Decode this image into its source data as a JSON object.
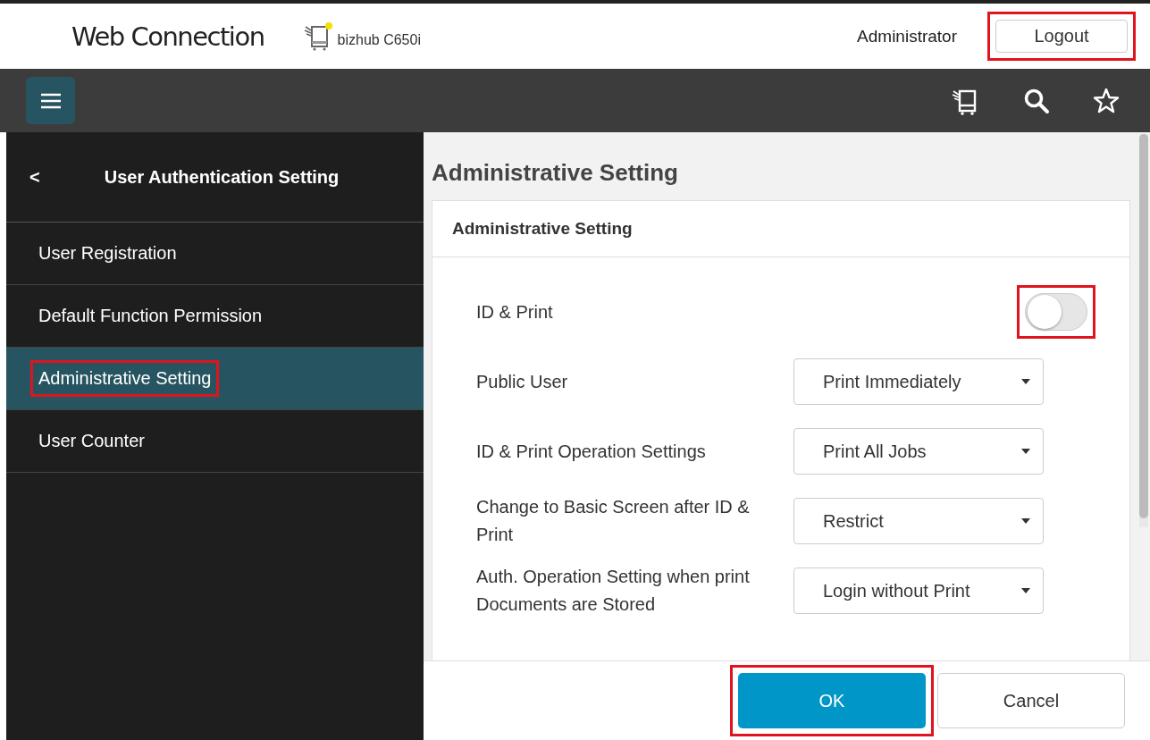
{
  "header": {
    "logo": "Web Connection",
    "device": "bizhub C650i",
    "user": "Administrator",
    "logout": {
      "label": "Logout",
      "highlighted": true
    }
  },
  "sidebar": {
    "back": "<",
    "title": "User Authentication Setting",
    "items": [
      {
        "label": "User Registration",
        "selected": false,
        "highlighted": false
      },
      {
        "label": "Default Function Permission",
        "selected": false,
        "highlighted": false
      },
      {
        "label": "Administrative Setting",
        "selected": true,
        "highlighted": true
      },
      {
        "label": "User Counter",
        "selected": false,
        "highlighted": false
      }
    ]
  },
  "page_title": "Administrative Setting",
  "card": {
    "title": "Administrative Setting",
    "settings": [
      {
        "kind": "toggle",
        "label": "ID & Print",
        "on": false,
        "highlighted": true
      },
      {
        "kind": "select",
        "label": "Public User",
        "value": "Print Immediately",
        "highlighted": false
      },
      {
        "kind": "select",
        "label": "ID & Print Operation Settings",
        "value": "Print All Jobs",
        "highlighted": false
      },
      {
        "kind": "select",
        "label": "Change to Basic Screen after ID & Print",
        "value": "Restrict",
        "highlighted": false
      },
      {
        "kind": "select",
        "label": "Auth. Operation Setting when print Documents are Stored",
        "value": "Login without Print",
        "highlighted": false
      }
    ]
  },
  "footer": {
    "buttons": [
      {
        "label": "OK",
        "kind": "primary",
        "highlighted": true
      },
      {
        "label": "Cancel",
        "kind": "secondary",
        "highlighted": false
      }
    ]
  }
}
